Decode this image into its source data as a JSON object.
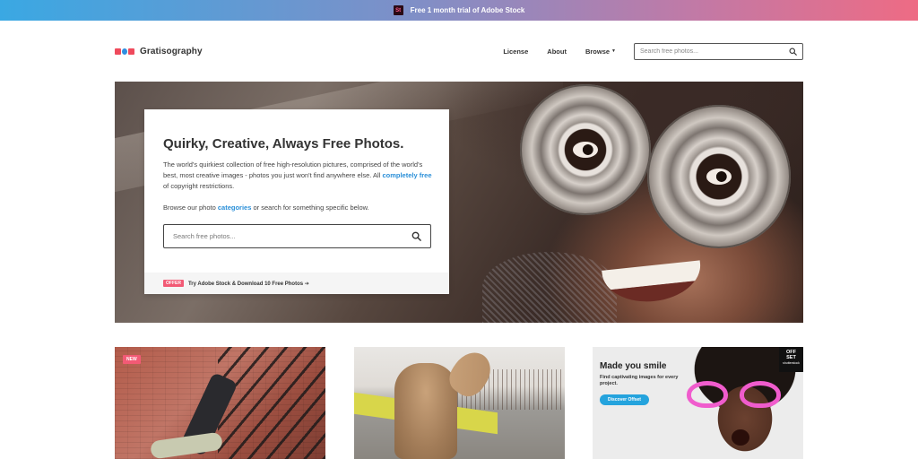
{
  "promo": {
    "icon_label": "St",
    "text": "Free 1 month trial of Adobe Stock"
  },
  "header": {
    "logo_text": "Gratisography",
    "nav": {
      "license": "License",
      "about": "About",
      "browse": "Browse"
    },
    "search": {
      "placeholder": "Search free photos..."
    }
  },
  "hero": {
    "title": "Quirky, Creative, Always Free Photos.",
    "desc_part1": "The world's quirkiest collection of free high-resolution pictures, comprised of the world's best, most creative images - photos you just won't find anywhere else. All ",
    "desc_link": "completely free",
    "desc_part2": " of copyright restrictions.",
    "browse_part1": "Browse our photo ",
    "browse_link": "categories",
    "browse_part2": " or search for something specific below.",
    "search": {
      "placeholder": "Search free photos..."
    },
    "offer": {
      "badge": "OFFER",
      "text": "Try Adobe Stock & Download 10 Free Photos ➔"
    }
  },
  "tiles": {
    "tile1": {
      "badge": "NEW"
    },
    "ad": {
      "title": "Made you smile",
      "subtitle": "Find captivating images for every project.",
      "button": "Discover Offset",
      "logo_line1": "OFF",
      "logo_line2": "SET",
      "logo_small": "shutterstock"
    }
  },
  "colors": {
    "accent_blue": "#2a8fd8",
    "badge_pink": "#f25a75",
    "ad_button": "#24a3dd"
  }
}
